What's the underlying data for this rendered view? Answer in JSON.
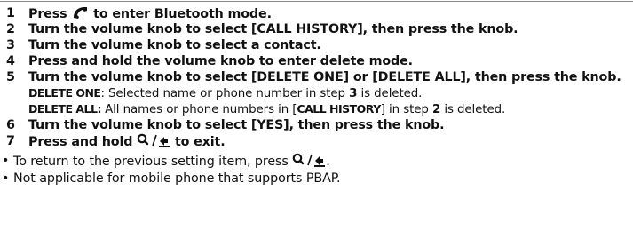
{
  "steps": [
    {
      "num": "1",
      "text_a": "Press",
      "icon": "phone-handset-icon",
      "text_b": "to enter Bluetooth mode."
    },
    {
      "num": "2",
      "text": "Turn the volume knob to select [CALL HISTORY], then press the knob."
    },
    {
      "num": "3",
      "text": "Turn the volume knob to select a contact."
    },
    {
      "num": "4",
      "text": "Press and hold the volume knob to enter delete mode."
    },
    {
      "num": "5",
      "text": "Turn the volume knob to select [DELETE ONE] or [DELETE ALL], then press the knob."
    },
    {
      "num": "6",
      "text": "Turn the volume knob to select [YES], then press the knob."
    },
    {
      "num": "7",
      "text_a": "Press and hold",
      "icon": "search-back-icon",
      "text_b": "to exit."
    }
  ],
  "delete_one": {
    "label": "DELETE ONE",
    "text_a": ": Selected name or phone number in step",
    "step": "3",
    "text_b": "is deleted."
  },
  "delete_all": {
    "label": "DELETE ALL:",
    "text_a": "All names or phone numbers in [",
    "call_history": "CALL HISTORY",
    "text_b": "] in step",
    "step": "2",
    "text_c": "is deleted."
  },
  "notes": [
    {
      "bullet": "•",
      "text_a": "To return to the previous setting item, press",
      "icon": "search-back-icon",
      "text_b": "."
    },
    {
      "bullet": "•",
      "text": "Not applicable for mobile phone that supports PBAP."
    }
  ]
}
